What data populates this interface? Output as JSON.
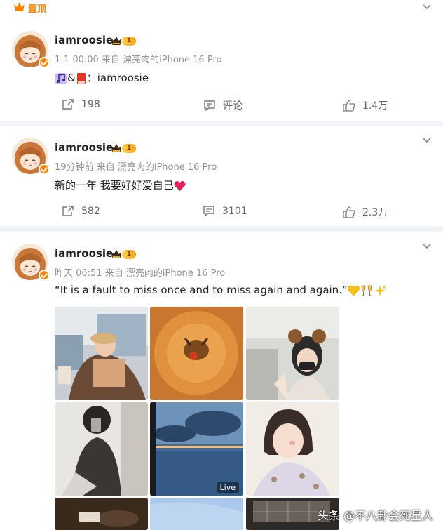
{
  "pinned": {
    "label": "置顶"
  },
  "posts": [
    {
      "username": "iamroosie",
      "level": "1",
      "time": "1-1 00:00",
      "source_prefix": "来自",
      "source": "漂亮肉的iPhone 16 Pro",
      "text": "：iamroosie",
      "emoji": [
        "music-note",
        "ampersand",
        "red-book"
      ],
      "actions": {
        "share": "198",
        "comment": "评论",
        "like": "1.4万"
      }
    },
    {
      "username": "iamroosie",
      "level": "1",
      "time": "19分钟前",
      "source_prefix": "来自",
      "source": "漂亮肉的iPhone 16 Pro",
      "text": "新的一年 我要好好爱自己",
      "emoji": [
        "red-heart"
      ],
      "actions": {
        "share": "582",
        "comment": "3101",
        "like": "2.3万"
      }
    },
    {
      "username": "iamroosie",
      "level": "1",
      "time": "昨天 06:51",
      "source_prefix": "来自",
      "source": "漂亮肉的iPhone 16 Pro",
      "text": "“It is a fault to miss once and to miss again and again.”",
      "emoji": [
        "yellow-heart",
        "clinking-glasses",
        "sparkles"
      ],
      "live_label": "Live"
    }
  ],
  "watermark": "头条 @不八卦会死星人",
  "colors": {
    "accent": "#ff8200",
    "meta": "#939393",
    "heart": "#e0245e"
  }
}
